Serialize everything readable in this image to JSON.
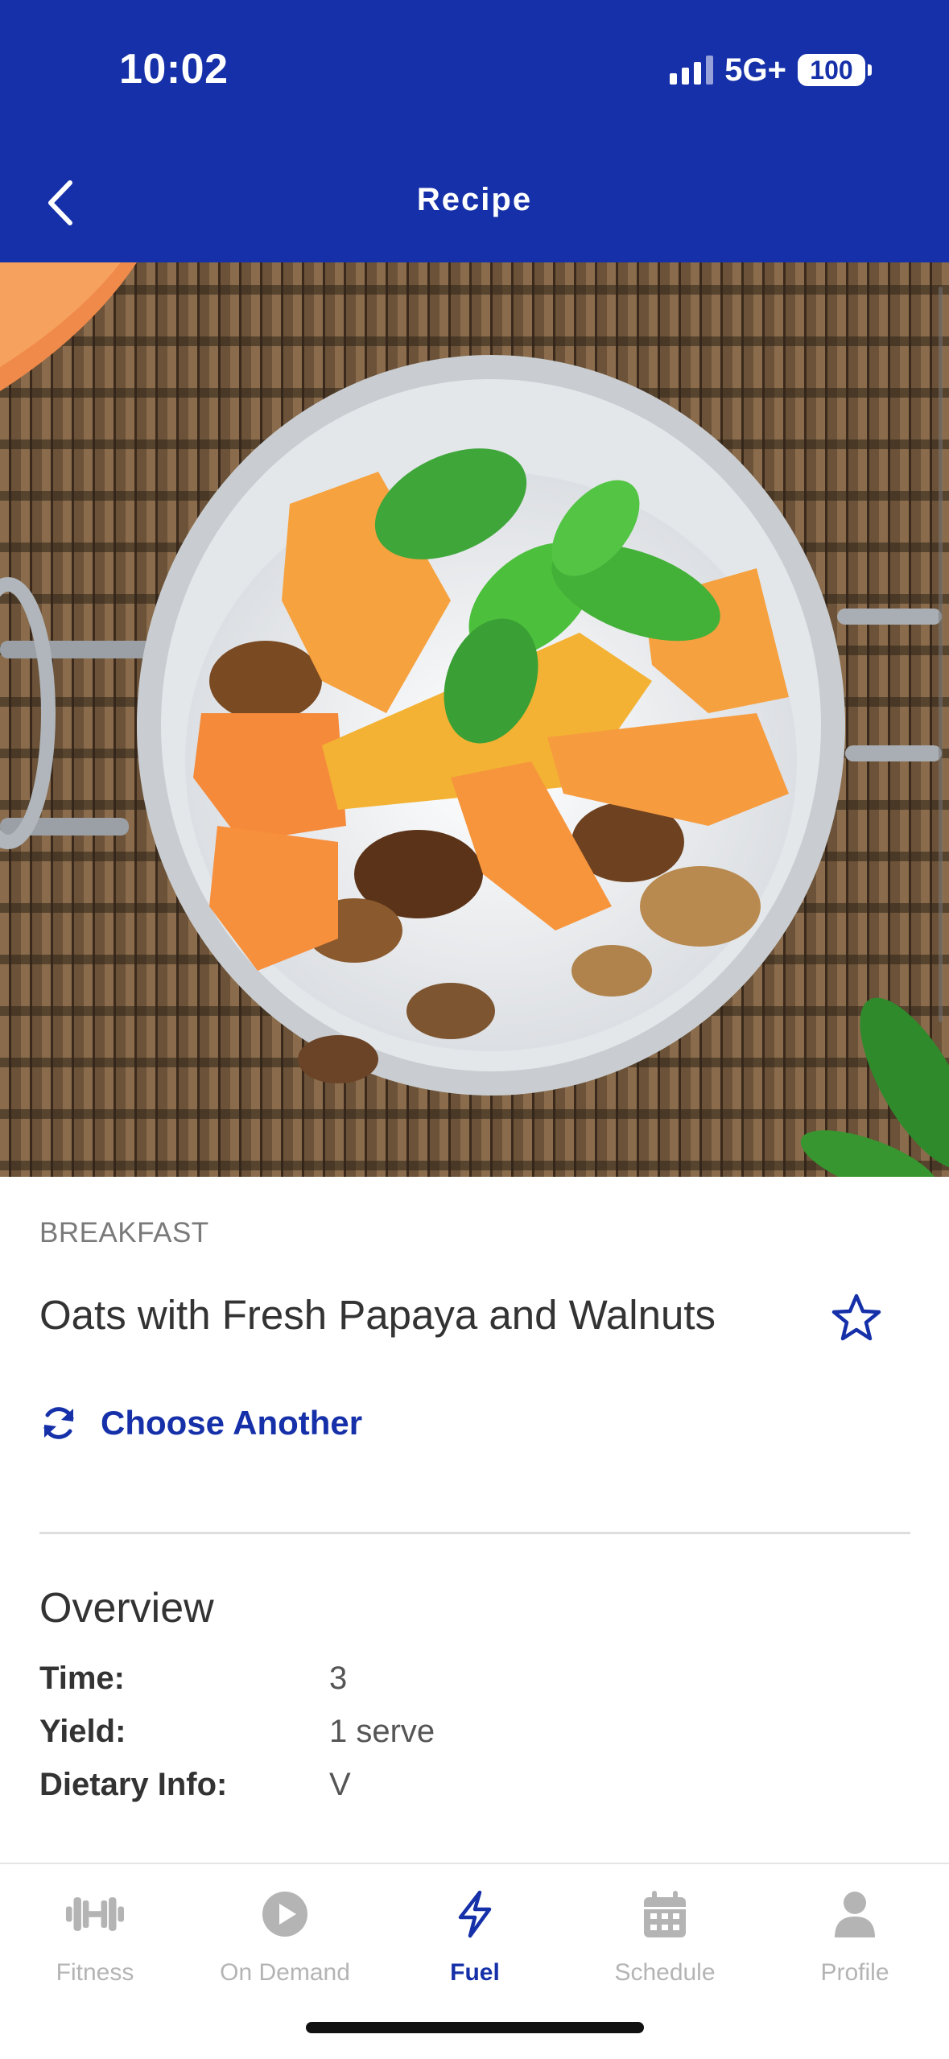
{
  "status_bar": {
    "time": "10:02",
    "network": "5G+",
    "battery": "100"
  },
  "header": {
    "title": "Recipe"
  },
  "recipe": {
    "category": "BREAKFAST",
    "title": "Oats with Fresh Papaya and Walnuts",
    "choose_another_label": "Choose Another"
  },
  "overview": {
    "heading": "Overview",
    "rows": [
      {
        "label": "Time:",
        "value": "3"
      },
      {
        "label": "Yield:",
        "value": "1 serve"
      },
      {
        "label": "Dietary Info:",
        "value": "V"
      }
    ]
  },
  "tabbar": {
    "tabs": [
      {
        "label": "Fitness",
        "icon": "dumbbell-icon",
        "active": false
      },
      {
        "label": "On Demand",
        "icon": "play-icon",
        "active": false
      },
      {
        "label": "Fuel",
        "icon": "lightning-icon",
        "active": true
      },
      {
        "label": "Schedule",
        "icon": "calendar-icon",
        "active": false
      },
      {
        "label": "Profile",
        "icon": "person-icon",
        "active": false
      }
    ]
  },
  "colors": {
    "brand": "#1530a8",
    "inactive_tab": "#b4b4b4",
    "text_primary": "#333333"
  }
}
